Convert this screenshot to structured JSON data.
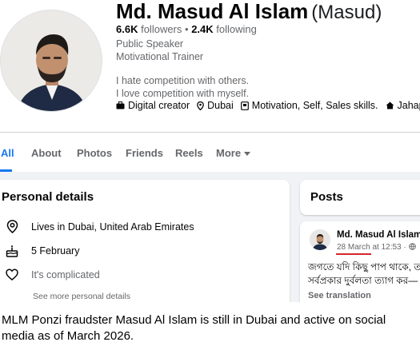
{
  "profile": {
    "name": "Md. Masud Al Islam",
    "nickname": "(Masud)",
    "followers": "6.6K",
    "followers_label": "followers",
    "separator": "•",
    "following": "2.4K",
    "following_label": "following",
    "role_1": "Public Speaker",
    "role_2": "Motivational Trainer",
    "bio_1": "I hate competition with others.",
    "bio_2": "I love competition with myself.",
    "tags": {
      "category": "Digital creator",
      "location": "Dubai",
      "interests": "Motivation, Self, Sales skills.",
      "hometown": "Jahapur Ka"
    }
  },
  "tabs": {
    "all": "All",
    "about": "About",
    "photos": "Photos",
    "friends": "Friends",
    "reels": "Reels",
    "more": "More"
  },
  "personal_details": {
    "title": "Personal details",
    "lives_in": "Lives in Dubai, United Arab Emirates",
    "birthday": "5 February",
    "relationship": "It's complicated",
    "see_more": "See more personal details"
  },
  "posts": {
    "title": "Posts",
    "author": "Md. Masud Al Islam",
    "date": "28 March",
    "time": "at 12:53 ·",
    "text_line_1": "জগতে যদি কিছু পাপ থাকে, ত",
    "text_line_2": "সর্বপ্রকার দুর্বলতা ত্যাগ কর—",
    "see_translation": "See translation"
  },
  "caption": "MLM Ponzi fraudster Masud Al Islam is still in Dubai and active on social media as of March 2026.",
  "colors": {
    "accent": "#1877f2",
    "highlight_underline": "#d7262b",
    "feed_background": "#f0f2f5"
  }
}
